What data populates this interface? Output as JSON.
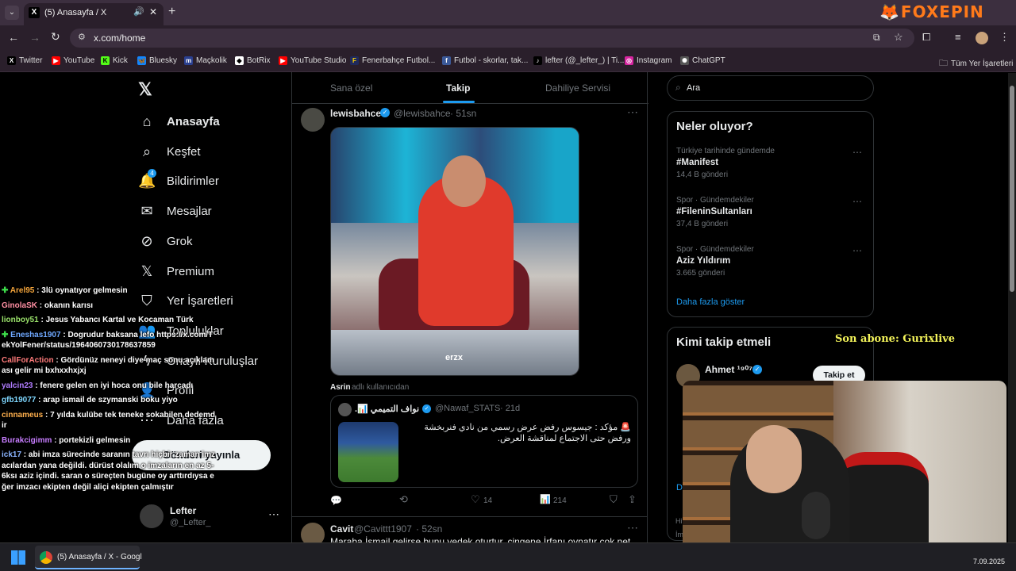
{
  "browser": {
    "tab_title": "(5) Anasayfa / X",
    "address": "x.com/home",
    "bookmarks": [
      "Twitter",
      "YouTube",
      "Kick",
      "Bluesky",
      "Maçkolik",
      "BotRix",
      "YouTube Studio",
      "Fenerbahçe Futbol...",
      "Futbol - skorlar, tak...",
      "lefter (@_lefter_) | Ti...",
      "Instagram",
      "ChatGPT"
    ],
    "all_bookmarks": "Tüm Yer İşaretleri"
  },
  "overlay": {
    "logo": "FOXEPIN",
    "last_sub": "Son abone: Gurixlive"
  },
  "nav": {
    "items": [
      "Anasayfa",
      "Keşfet",
      "Bildirimler",
      "Mesajlar",
      "Grok",
      "Premium",
      "Yer İşaretleri",
      "Topluluklar",
      "Onaylı Kuruluşlar",
      "Profil",
      "Daha fazla"
    ],
    "notif_badge": "4",
    "post_button": "Gönderi yayınla",
    "account_name": "Lefter",
    "account_handle": "@_Lefter_"
  },
  "feed": {
    "tabs": [
      "Sana özel",
      "Takip",
      "Dahiliye Servisi"
    ],
    "post1": {
      "name": "lewisbahce",
      "handle": "@lewisbahce",
      "time": "· 51sn",
      "image_caption": "erzx",
      "tagged": "Asrin",
      "tagged_suffix": "adlı kullanıcıdan",
      "quote_name": "نواف التميمي 📊.",
      "quote_handle": "@Nawaf_STATS",
      "quote_time": "· 21d",
      "quote_text": "🚨 مؤكد : جيسوس رفض عرض رسمي من نادي فنربخشة ورفض حتى الاجتماع لمناقشة العرض.",
      "likes": "14",
      "views": "214"
    },
    "post2": {
      "name": "Cavit",
      "handle": "@Cavittt1907",
      "time": "· 52sn",
      "text": "Maraba İsmail gelirse bunu yedek oturtur, çingene İrfanı oynatır çok net."
    }
  },
  "right": {
    "search_placeholder": "Ara",
    "trends_title": "Neler oluyor?",
    "trends": [
      {
        "meta": "Türkiye tarihinde gündemde",
        "title": "#Manifest",
        "count": "14,4 B gönderi"
      },
      {
        "meta": "Spor · Gündemdekiler",
        "title": "#FileninSultanları",
        "count": "37,4 B gönderi"
      },
      {
        "meta": "Spor · Gündemdekiler",
        "title": "Aziz Yıldırım",
        "count": "3.665 gönderi"
      }
    ],
    "show_more": "Daha fazla göster",
    "who_title": "Kimi takip etmeli",
    "who_name": "Ahmet ¹⁹⁰⁷",
    "follow": "Takip et",
    "partial_text": "Da",
    "footer_partial_1": "Hi",
    "footer_partial_2": "İm"
  },
  "chat": [
    {
      "user": "Arel95",
      "color": "#f2a33a",
      "icon": true,
      "text": " : 3lü oynatıyor gelmesin"
    },
    {
      "user": "GinolaSK",
      "color": "#ff8fa3",
      "icon": false,
      "text": " : okanın karısı"
    },
    {
      "user": "lionboy51",
      "color": "#9be36b",
      "icon": false,
      "text": " : Jesus Yabancı Kartal ve Kocaman Türk"
    },
    {
      "user": "Eneshas1907",
      "color": "#6fa8ff",
      "icon": true,
      "text": " : Dogrudur baksana lefo https://x.com/TekYolFener/status/1964060730178637859"
    },
    {
      "user": "CallForAction",
      "color": "#ff7b7b",
      "icon": false,
      "text": " : Gördünüz neneyi diye maç sonu açıklaması gelir mi bxhxxhxjxj"
    },
    {
      "user": "yalcin23",
      "color": "#b07cff",
      "icon": false,
      "text": " : fenere gelen en iyi hoca onu bile harcadı"
    },
    {
      "user": "gfb19077",
      "color": "#7fd7ff",
      "icon": false,
      "text": " : arap ismail de szymanski boku yiyo"
    },
    {
      "user": "cinnameus",
      "color": "#ffb04d",
      "icon": false,
      "text": " : 7 yılda kulübe tek teneke sokabilen dedemdir"
    },
    {
      "user": "Burakcigimm",
      "color": "#c77dff",
      "icon": false,
      "text": " : portekizli gelmesin"
    },
    {
      "user": "ick17",
      "color": "#8ab4ff",
      "icon": false,
      "text": " : abi imza sürecinde saranın tavrı hiçbir zaman imzacılardan yana değildi. dürüst olalım o imzaların en az 5-6ksı aziz içindi. saran o süreçten bugüne oy arttırdıysa eğer imzacı ekipten değil aliçi ekipten çalmıştır"
    }
  ],
  "taskbar": {
    "app_label": "(5) Anasayfa / X - Googl",
    "date": "7.09.2025"
  }
}
